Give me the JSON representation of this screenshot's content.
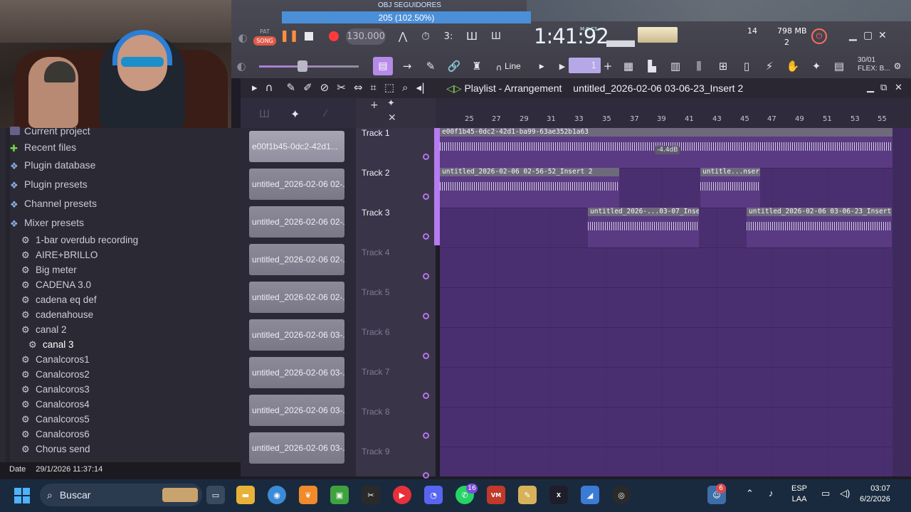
{
  "overlay": {
    "follow_label": "OBJ SEGUIDORES",
    "follow_value": "205 (102.50%)"
  },
  "transport": {
    "pat_label": "PAT",
    "song_label": "SONG",
    "tempo": "130.000",
    "time": "1:41:92",
    "time_unit": "M:S:CS",
    "cpu_num": "14",
    "memory": "798 MB",
    "poly": "2"
  },
  "toolbar2": {
    "snap_mode": "Line",
    "pattern_num": "1",
    "flex_label": "30/01\nFLEX: B..."
  },
  "browser": {
    "items": [
      {
        "label": "Current project",
        "icon": "folder-icon"
      },
      {
        "label": "Recent files",
        "icon": "recent-icon"
      },
      {
        "label": "Plugin database",
        "icon": "plugin-icon"
      },
      {
        "label": "Plugin presets",
        "icon": "plugin-icon"
      },
      {
        "label": "Channel presets",
        "icon": "plugin-icon"
      },
      {
        "label": "Mixer presets",
        "icon": "plugin-icon"
      }
    ],
    "presets": [
      "1-bar overdub recording",
      "AIRE+BRILLO",
      "Big meter",
      "CADENA 3.0",
      "cadena eq def",
      "cadenahouse",
      "canal 2",
      "canal 3",
      "Canalcoros1",
      "Canalcoros2",
      "Canalcoros3",
      "Canalcoros4",
      "Canalcoros5",
      "Canalcoros6",
      "Chorus send"
    ],
    "selected_preset": "canal 3",
    "footer_label": "Date",
    "footer_value": "29/1/2026 11:37:14"
  },
  "playlist": {
    "title": "Playlist - Arrangement",
    "crumb": "untitled_2026-02-06 03-06-23_Insert 2",
    "pattern_clips": [
      "e00f1b45-0dc2-42d1...",
      "untitled_2026-02-06 02-...",
      "untitled_2026-02-06 02-...",
      "untitled_2026-02-06 02-...",
      "untitled_2026-02-06 02-...",
      "untitled_2026-02-06 03-...",
      "untitled_2026-02-06 03-...",
      "untitled_2026-02-06 03-...",
      "untitled_2026-02-06 03-..."
    ],
    "tracks": [
      "Track 1",
      "Track 2",
      "Track 3",
      "Track 4",
      "Track 5",
      "Track 6",
      "Track 7",
      "Track 8",
      "Track 9"
    ],
    "ruler": [
      "25",
      "27",
      "29",
      "31",
      "33",
      "35",
      "37",
      "39",
      "41",
      "43",
      "45",
      "47",
      "49",
      "51",
      "53",
      "55"
    ],
    "clips": [
      {
        "label": "e00f1b45-0dc2-42d1-ba99-63ae352b1a63"
      },
      {
        "label": "untitled_2026-02-06 02-56-52_Insert 2"
      },
      {
        "label": "untitle...nsert 2"
      },
      {
        "label": "untitled_2026-...03-07_Insert 2"
      },
      {
        "label": "untitled_2026-02-06 03-06-23_Insert 2"
      }
    ],
    "clip_volume": "-4.4dB"
  },
  "taskbar": {
    "search": "Buscar",
    "lang_top": "ESP",
    "lang_bottom": "LAA",
    "clock_time": "03:07",
    "clock_date": "6/2/2026",
    "badge_whatsapp": "16",
    "badge_people": "6"
  },
  "colors": {
    "accent": "#b57bf0",
    "playlist_bg": "#4a2f70",
    "record": "#ff3a3a",
    "song_badge": "#e05a4a"
  }
}
